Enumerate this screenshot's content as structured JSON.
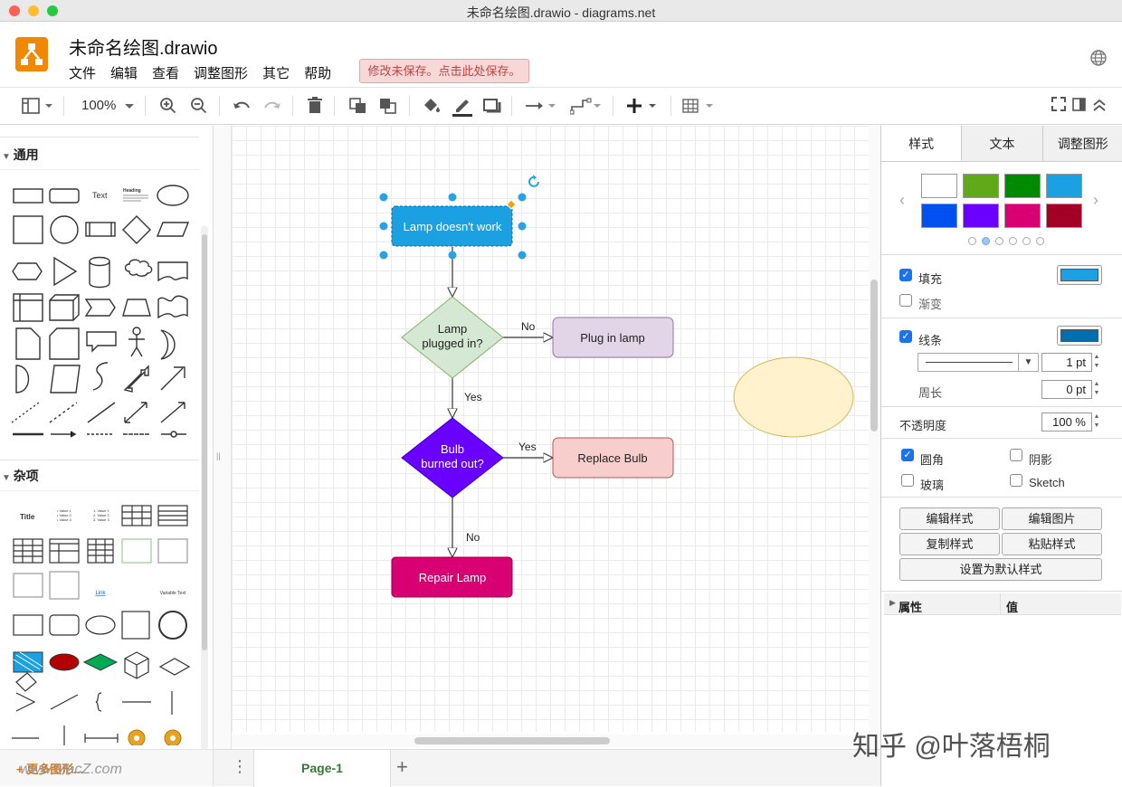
{
  "window": {
    "title": "未命名绘图.drawio - diagrams.net"
  },
  "app": {
    "doc_title": "未命名绘图.drawio",
    "menu": [
      "文件",
      "编辑",
      "查看",
      "调整图形",
      "其它",
      "帮助"
    ],
    "unsaved_notice": "修改未保存。点击此处保存。"
  },
  "toolbar": {
    "zoom": "100%"
  },
  "sidebar": {
    "general_title": "通用",
    "misc_title": "杂项",
    "more_shapes": "+ 更多图形...",
    "shape_text": "Text",
    "shape_heading": "Heading",
    "misc_title_label": "Title",
    "misc_link": "Link",
    "misc_variable": "Variable Text"
  },
  "diagram": {
    "node1": "Lamp doesn't work",
    "decision1": [
      "Lamp",
      "plugged in?"
    ],
    "plug": "Plug in lamp",
    "decision2": [
      "Bulb",
      "burned out?"
    ],
    "replace": "Replace Bulb",
    "repair": "Repair Lamp",
    "edge_no1": "No",
    "edge_yes1": "Yes",
    "edge_yes2": "Yes",
    "edge_no2": "No"
  },
  "panel": {
    "tabs": [
      "样式",
      "文本",
      "调整图形"
    ],
    "colors": [
      "#ffffff",
      "#60a917",
      "#008a00",
      "#1ba1e2",
      "#0050ef",
      "#6a00ff",
      "#d80073",
      "#a20025"
    ],
    "fill": "填充",
    "gradient": "渐变",
    "line": "线条",
    "line_width": "1 pt",
    "perimeter": "周长",
    "perimeter_val": "0 pt",
    "opacity": "不透明度",
    "opacity_val": "100 %",
    "rounded": "圆角",
    "shadow": "阴影",
    "glass": "玻璃",
    "sketch": "Sketch",
    "edit_style": "编辑样式",
    "edit_image": "编辑图片",
    "copy_style": "复制样式",
    "paste_style": "粘贴样式",
    "set_default": "设置为默认样式",
    "prop_col": "属性",
    "val_col": "值",
    "fill_color": "#1ba1e2",
    "line_color": "#006eaf"
  },
  "pages": {
    "page1": "Page-1"
  },
  "watermark": {
    "zhihu": "知乎 @叶落梧桐",
    "site": "www.MacZ.com"
  }
}
